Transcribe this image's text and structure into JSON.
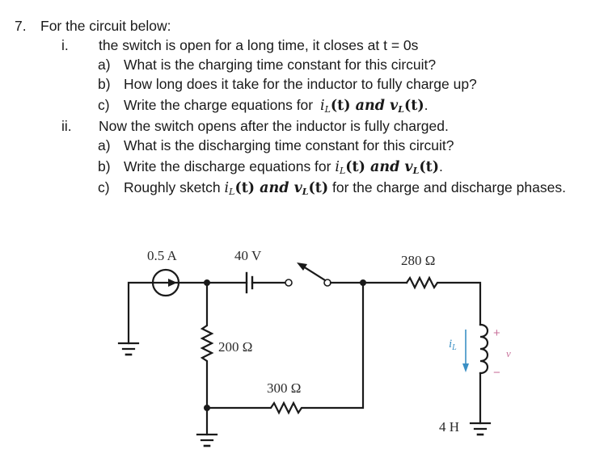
{
  "question": {
    "number": "7.",
    "intro": "For  the circuit below:",
    "parts": [
      {
        "roman": "i.",
        "text": "the switch is open for a long time, it closes at t = 0s",
        "subparts": [
          {
            "letter": "a)",
            "text": "What is the charging time constant for this circuit?"
          },
          {
            "letter": "b)",
            "text": "How long does it take for the inductor to fully charge up?"
          },
          {
            "letter": "c)",
            "text_before": "Write the charge equations for ",
            "math": {
              "i": "i",
              "sub": "L",
              "t": "(t)",
              "and": " and ",
              "v": "v",
              "sub2": "L",
              "t2": "(t)"
            },
            "text_after": "."
          }
        ]
      },
      {
        "roman": "ii.",
        "text": "Now the switch opens after the inductor is fully charged.",
        "subparts": [
          {
            "letter": "a)",
            "text": "What is the discharging time constant for this circuit?"
          },
          {
            "letter": "b)",
            "text_before": "Write the discharge equations for ",
            "math": {
              "i": "i",
              "sub": "L",
              "t": "(t)",
              "and": " and ",
              "v": "v",
              "sub2": "L",
              "t2": "(t)"
            },
            "text_after": "."
          },
          {
            "letter": "c)",
            "text_before": "Roughly sketch ",
            "math": {
              "i": "i",
              "sub": "L",
              "t": "(t)",
              "and": " and ",
              "v": "v",
              "sub2": "L",
              "t2": "(t)"
            },
            "text_after": " for the charge and discharge phases."
          }
        ]
      }
    ]
  },
  "circuit": {
    "current_source": "0.5 A",
    "voltage_source": "40 V",
    "resistor_top_right": "280 Ω",
    "resistor_vertical": "200 Ω",
    "resistor_bottom": "300 Ω",
    "inductor": "4 H",
    "current_label": "i",
    "current_label_sub": "L",
    "voltage_label": "v",
    "plus": "+",
    "minus": "−",
    "colors": {
      "wire": "#1a1a1a",
      "current_arrow": "#3a8fc4",
      "voltage_marks": "#c8709a"
    }
  }
}
